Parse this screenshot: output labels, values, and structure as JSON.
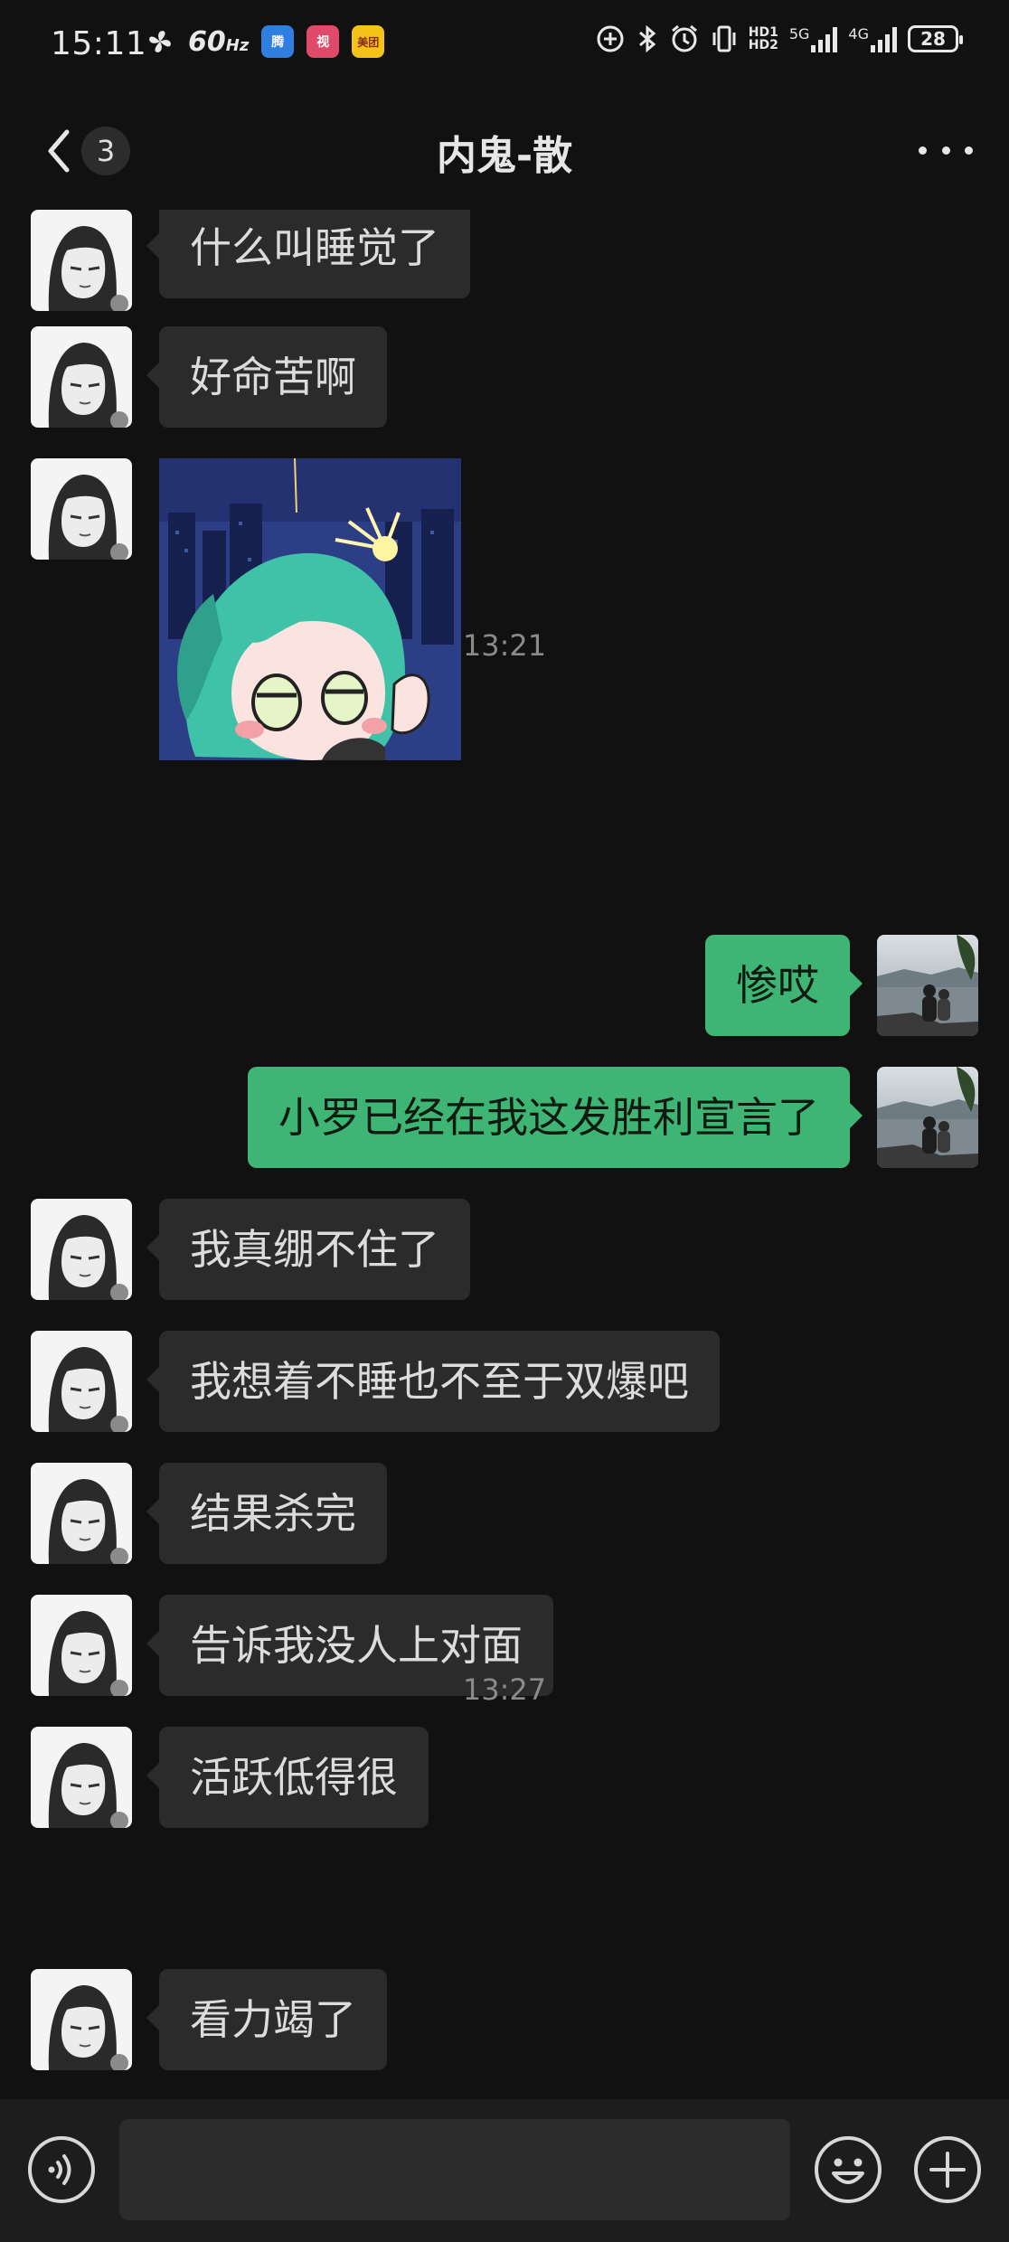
{
  "status_bar": {
    "time": "15:11",
    "refresh_rate": "60",
    "refresh_unit": "Hz",
    "hd_label_1": "HD1",
    "hd_label_2": "HD2",
    "net_1": "5G",
    "net_2": "4G",
    "battery": "28",
    "app_badges": [
      "腾",
      "视",
      "美团"
    ]
  },
  "header": {
    "back_icon": "chevron-left-icon",
    "unread_count": "3",
    "title": "内鬼-散",
    "more_icon": "more-dots-icon"
  },
  "messages": [
    {
      "type": "text",
      "side": "in",
      "text": "什么叫睡觉了"
    },
    {
      "type": "text",
      "side": "in",
      "text": "好命苦啊"
    },
    {
      "type": "sticker",
      "side": "in"
    },
    {
      "type": "time",
      "text": "13:21"
    },
    {
      "type": "text",
      "side": "out",
      "text": "惨哎"
    },
    {
      "type": "text",
      "side": "out",
      "text": "小罗已经在我这发胜利宣言了"
    },
    {
      "type": "text",
      "side": "in",
      "text": "我真绷不住了"
    },
    {
      "type": "text",
      "side": "in",
      "text": "我想着不睡也不至于双爆吧"
    },
    {
      "type": "text",
      "side": "in",
      "text": "结果杀完"
    },
    {
      "type": "text",
      "side": "in",
      "text": "告诉我没人上对面"
    },
    {
      "type": "text",
      "side": "in",
      "text": "活跃低得很"
    },
    {
      "type": "time",
      "text": "13:27"
    },
    {
      "type": "text",
      "side": "in",
      "text": "看力竭了"
    }
  ],
  "input_bar": {
    "voice_icon": "voice-icon",
    "text_value": "",
    "emoji_icon": "emoji-icon",
    "plus_icon": "plus-icon"
  },
  "colors": {
    "background": "#111111",
    "incoming_bubble": "#2b2b2b",
    "outgoing_bubble": "#3eb575",
    "timestamp": "#8a8a8a"
  }
}
